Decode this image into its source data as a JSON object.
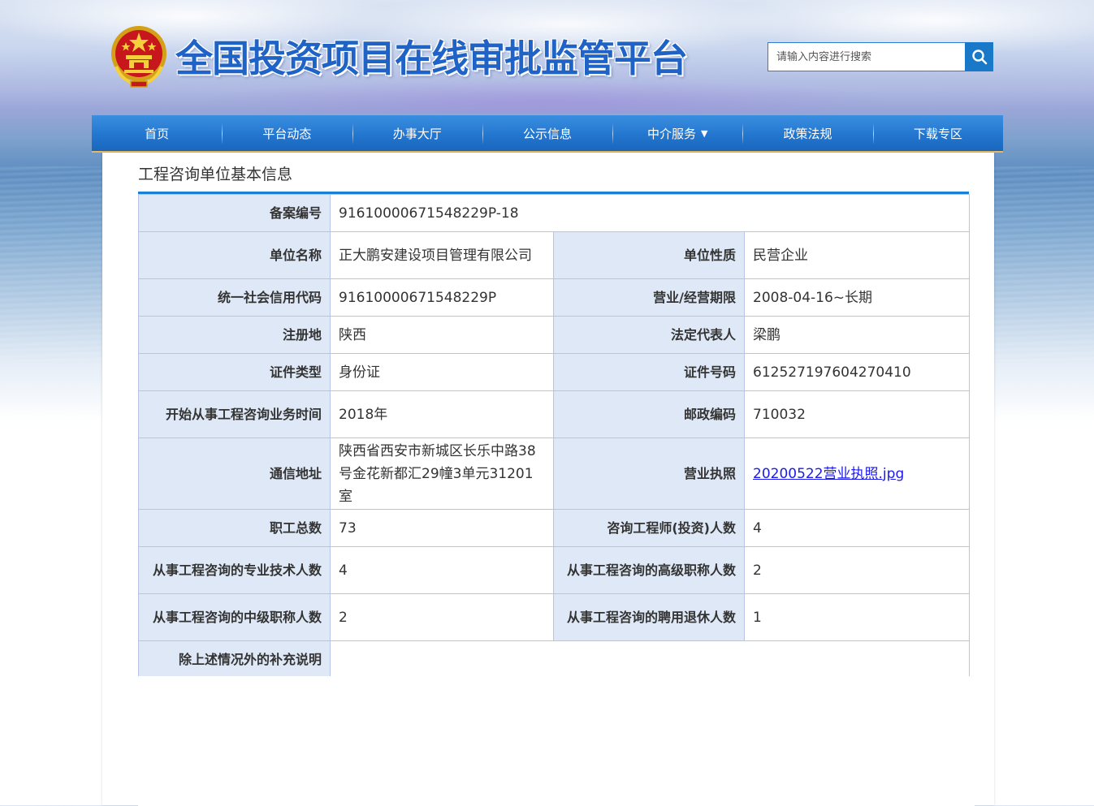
{
  "header": {
    "site_title": "全国投资项目在线审批监管平台",
    "search_placeholder": "请输入内容进行搜索"
  },
  "nav": [
    {
      "label": "首页"
    },
    {
      "label": "平台动态"
    },
    {
      "label": "办事大厅"
    },
    {
      "label": "公示信息"
    },
    {
      "label": "中介服务",
      "has_dropdown": true
    },
    {
      "label": "政策法规"
    },
    {
      "label": "下载专区"
    }
  ],
  "nav_caret": "▼",
  "page": {
    "title": "工程咨询单位基本信息"
  },
  "info": {
    "record_no": {
      "label": "备案编号",
      "value": "91610000671548229P-18"
    },
    "unit_name": {
      "label": "单位名称",
      "value": "正大鹏安建设项目管理有限公司"
    },
    "unit_nature": {
      "label": "单位性质",
      "value": "民营企业"
    },
    "credit_code": {
      "label": "统一社会信用代码",
      "value": "91610000671548229P"
    },
    "business_term": {
      "label": "营业/经营期限",
      "value": "2008-04-16~长期"
    },
    "reg_place": {
      "label": "注册地",
      "value": "陕西"
    },
    "legal_rep": {
      "label": "法定代表人",
      "value": "梁鹏"
    },
    "cert_type": {
      "label": "证件类型",
      "value": "身份证"
    },
    "cert_no": {
      "label": "证件号码",
      "value": "612527197604270410"
    },
    "start_time": {
      "label": "开始从事工程咨询业务时间",
      "value": "2018年"
    },
    "postcode": {
      "label": "邮政编码",
      "value": "710032"
    },
    "address": {
      "label": "通信地址",
      "value": "陕西省西安市新城区长乐中路38号金花新都汇29幢3单元31201室"
    },
    "license": {
      "label": "营业执照",
      "value": "20200522营业执照.jpg"
    },
    "staff_total": {
      "label": "职工总数",
      "value": "73"
    },
    "engineers": {
      "label": "咨询工程师(投资)人数",
      "value": "4"
    },
    "tech_staff": {
      "label": "从事工程咨询的专业技术人数",
      "value": "4"
    },
    "senior_title": {
      "label": "从事工程咨询的高级职称人数",
      "value": "2"
    },
    "middle_title": {
      "label": "从事工程咨询的中级职称人数",
      "value": "2"
    },
    "retired": {
      "label": "从事工程咨询的聘用退休人数",
      "value": "1"
    },
    "supplement": {
      "label": "除上述情况外的补充说明",
      "value": ""
    }
  },
  "colors": {
    "primary_blue": "#1f63c6",
    "nav_blue": "#2376cf",
    "label_bg": "#dfe8f6",
    "border": "#b8c4e6",
    "link": "#1a1aee"
  }
}
